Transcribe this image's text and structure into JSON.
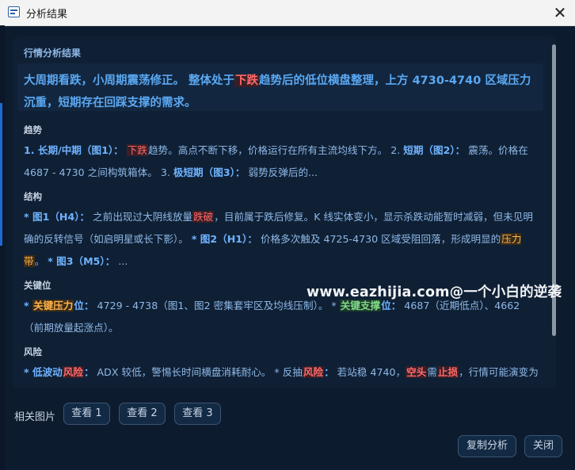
{
  "window": {
    "title": "分析结果",
    "close_glyph": "✕"
  },
  "analysis": {
    "section_title": "行情分析结果",
    "summary": {
      "p1": "大周期看跌，小周期震荡修正。 整体处于",
      "hl": "下跌",
      "p2": "趋势后的低位横盘整理，上方 4730-4740 区域压力沉重，短期存在回踩支撑的需求。"
    },
    "trend": {
      "heading": "趋势",
      "a1": "1. 长期/中期（图1）：",
      "a2": "下跌",
      "a3": "趋势。高点不断下移，价格运行在所有主流均线下方。 2. ",
      "a4": "短期",
      "a5": "（图2）：",
      "a6": " 震荡。价格在 4687 - 4730 之间构筑箱体。 3. ",
      "a7": "极短期（图3）：",
      "a8": " 弱势反弹后的..."
    },
    "structure": {
      "heading": "结构",
      "b1": "* 图1（H4）：",
      "b2": " 之前出现过大阴线放量",
      "b3": "跌破",
      "b4": "，目前属于跌后修复。K 线实体变小，显示杀跌动能暂时减弱，但未见明确的反转信号（如启明星或长下影）。 ",
      "b5": "* 图2（H1）：",
      "b6": " 价格多次触及 4725-4730 区域受阻回落，形成明显的",
      "b7": "压力带",
      "b8": "。 ",
      "b9": "* 图3（M5）：",
      "b10": " ..."
    },
    "key_levels": {
      "heading": "关键位",
      "c1": "* ",
      "c2": "关键压力",
      "c3": "位：",
      "c4": " 4729 - 4738（图1、图2 密集套牢区及均线压制）。 * ",
      "c5": "关键支撑",
      "c6": "位：",
      "c7": " 4687（近期低点）、4662（前期放量起涨点）。"
    },
    "risk": {
      "heading": "风险",
      "d1": "* 低波动",
      "d2": "风险",
      "d3": "：",
      "d4": " ADX 较低，警惕长时间横盘消耗耐心。 * 反抽",
      "d5": "风险",
      "d6": "：",
      "d7": " 若站稳 4740，",
      "d8": "空头",
      "d9": "需",
      "d10": "止损",
      "d11": "，行情可能演变为"
    },
    "watermark": "www.eazhijia.com@一个小白的逆袭"
  },
  "related": {
    "label": "相关图片",
    "buttons": [
      "查看 1",
      "查看 2",
      "查看 3"
    ]
  },
  "actions": {
    "copy": "复制分析",
    "close": "关闭"
  },
  "colors": {
    "background": "#0d1b2e",
    "panel": "#0f2035",
    "text_blue": "#8fb8e6",
    "accent_blue": "#5aa8f2",
    "highlight_red": "#ff6a6a",
    "highlight_orange": "#ffb24a",
    "highlight_green": "#7fd889"
  }
}
